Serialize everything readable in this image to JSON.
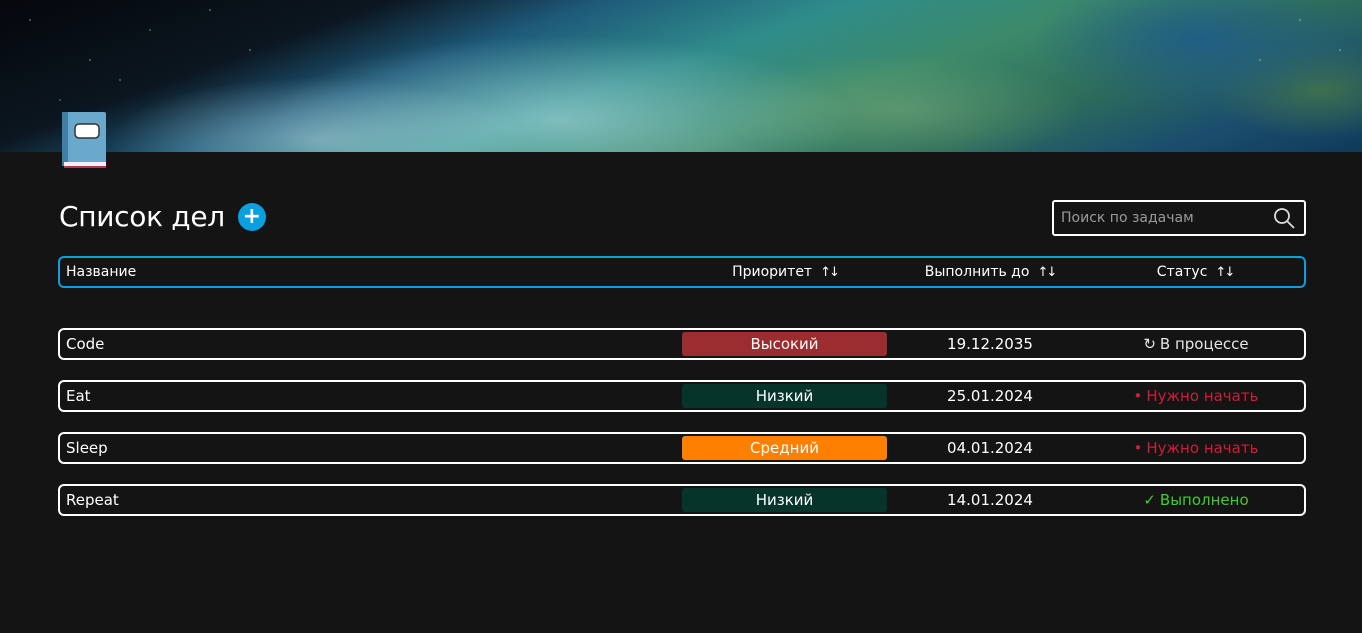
{
  "header": {
    "title": "Список дел",
    "add_label": "+"
  },
  "search": {
    "placeholder": "Поиск по задачам",
    "value": ""
  },
  "columns": {
    "name": "Название",
    "priority": "Приоритет",
    "due": "Выполнить до",
    "status": "Статус",
    "sort_glyph": "↑↓"
  },
  "tasks": [
    {
      "name": "Code",
      "priority": "Высокий",
      "priority_color": "#9b2c2f",
      "due": "19.12.2035",
      "status_icon": "↻",
      "status": "В процессе",
      "status_color": "#e6e6e6"
    },
    {
      "name": "Eat",
      "priority": "Низкий",
      "priority_color": "#04342a",
      "due": "25.01.2024",
      "status_icon": "•",
      "status": "Нужно начать",
      "status_color": "#d01c3a"
    },
    {
      "name": "Sleep",
      "priority": "Средний",
      "priority_color": "#ff8000",
      "due": "04.01.2024",
      "status_icon": "•",
      "status": "Нужно начать",
      "status_color": "#d01c3a"
    },
    {
      "name": "Repeat",
      "priority": "Низкий",
      "priority_color": "#04342a",
      "due": "14.01.2024",
      "status_icon": "✓",
      "status": "Выполнено",
      "status_color": "#3ccf2c"
    }
  ],
  "colors": {
    "accent": "#0aa0e0",
    "background": "#141414"
  }
}
